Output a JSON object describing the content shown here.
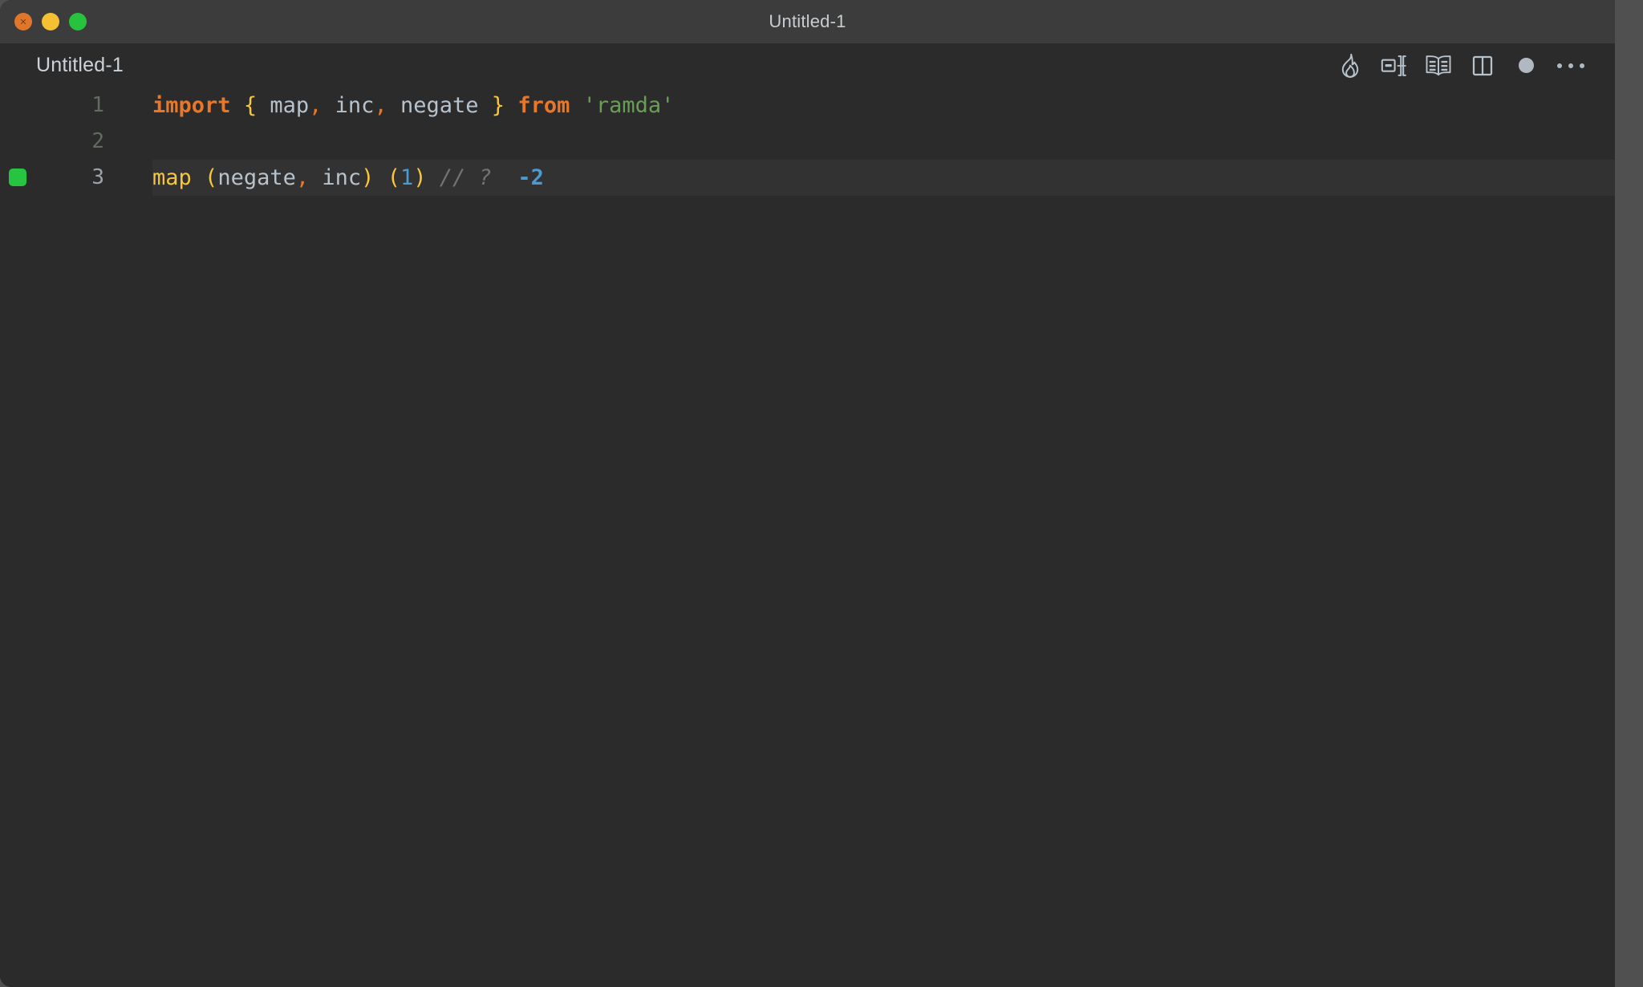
{
  "window": {
    "title": "Untitled-1",
    "traffic_lights": [
      {
        "name": "close",
        "color": "#e0762a"
      },
      {
        "name": "minimize",
        "color": "#f5c132"
      },
      {
        "name": "maximize",
        "color": "#27c33f"
      }
    ]
  },
  "tabbar": {
    "tab_label": "Untitled-1",
    "tools": [
      {
        "name": "quokka-flame-icon",
        "label": "Quokka"
      },
      {
        "name": "split-snippet-icon",
        "label": "Snippet"
      },
      {
        "name": "open-book-icon",
        "label": "Open Book"
      },
      {
        "name": "split-editor-icon",
        "label": "Split Editor"
      },
      {
        "name": "unsaved-dot-indicator",
        "label": "Unsaved"
      },
      {
        "name": "more-actions-ellipsis",
        "label": "More Actions..."
      }
    ]
  },
  "editor": {
    "active_line": 3,
    "marker_color": "#27c441",
    "lines": [
      {
        "number": "1",
        "marker": false,
        "tokens": [
          {
            "text": "import",
            "cls": "t-kw"
          },
          {
            "text": " ",
            "cls": "t-plain"
          },
          {
            "text": "{",
            "cls": "t-brace"
          },
          {
            "text": " ",
            "cls": "t-plain"
          },
          {
            "text": "map",
            "cls": "t-ident"
          },
          {
            "text": ",",
            "cls": "t-punct"
          },
          {
            "text": " ",
            "cls": "t-plain"
          },
          {
            "text": "inc",
            "cls": "t-ident"
          },
          {
            "text": ",",
            "cls": "t-punct"
          },
          {
            "text": " ",
            "cls": "t-plain"
          },
          {
            "text": "negate",
            "cls": "t-ident"
          },
          {
            "text": " ",
            "cls": "t-plain"
          },
          {
            "text": "}",
            "cls": "t-brace"
          },
          {
            "text": " ",
            "cls": "t-plain"
          },
          {
            "text": "from",
            "cls": "t-kw"
          },
          {
            "text": " ",
            "cls": "t-plain"
          },
          {
            "text": "'ramda'",
            "cls": "t-str"
          }
        ]
      },
      {
        "number": "2",
        "marker": false,
        "tokens": []
      },
      {
        "number": "3",
        "marker": true,
        "tokens": [
          {
            "text": "map",
            "cls": "t-fn"
          },
          {
            "text": " ",
            "cls": "t-plain"
          },
          {
            "text": "(",
            "cls": "t-paren"
          },
          {
            "text": "negate",
            "cls": "t-ident"
          },
          {
            "text": ",",
            "cls": "t-punct"
          },
          {
            "text": " ",
            "cls": "t-plain"
          },
          {
            "text": "inc",
            "cls": "t-ident"
          },
          {
            "text": ")",
            "cls": "t-paren"
          },
          {
            "text": " ",
            "cls": "t-plain"
          },
          {
            "text": "(",
            "cls": "t-paren"
          },
          {
            "text": "1",
            "cls": "t-num"
          },
          {
            "text": ")",
            "cls": "t-paren"
          },
          {
            "text": " ",
            "cls": "t-plain"
          },
          {
            "text": "//",
            "cls": "t-comment"
          },
          {
            "text": " ",
            "cls": "t-plain"
          },
          {
            "text": "?",
            "cls": "t-comment"
          },
          {
            "text": "  ",
            "cls": "t-plain"
          },
          {
            "text": "-2",
            "cls": "t-result"
          }
        ]
      }
    ]
  },
  "colors": {
    "window_background": "#2b2b2b",
    "titlebar_background": "#3c3c3c",
    "active_line_background": "#323232",
    "desktop_background": "#505050",
    "keyword": "#e8772a",
    "string": "#6a9e56",
    "number": "#4a9bd4",
    "identifier": "#b6c2cc",
    "brace": "#f8c63d",
    "comment": "#6f7478"
  }
}
